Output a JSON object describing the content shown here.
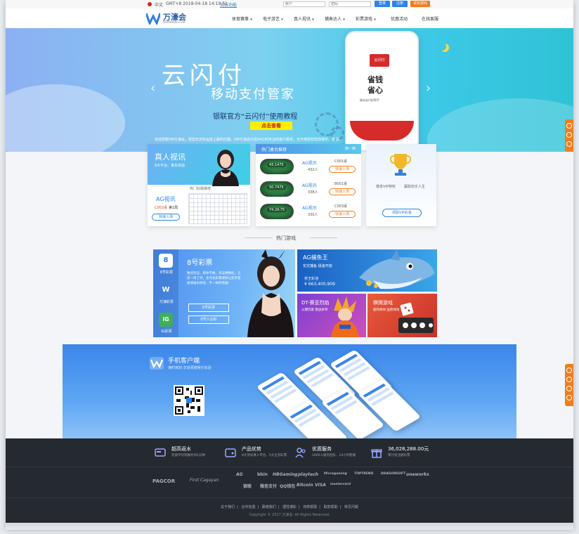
{
  "topbar": {
    "lang": "中文",
    "time": "GMT+8 2018-04-18 14:19:51",
    "demo_link": "试玩功能",
    "account_placeholder": "账户",
    "password_placeholder": "密码",
    "login": "登录",
    "register": "注册",
    "try_play": "试玩游戏"
  },
  "brand": {
    "name": "万濠会",
    "url": "WHHH688.COM",
    "color": "#2d5ea8"
  },
  "nav": [
    {
      "label": "体育赛事",
      "caret": true
    },
    {
      "label": "电子游艺",
      "caret": true
    },
    {
      "label": "真人视讯",
      "caret": true
    },
    {
      "label": "捕鱼达人",
      "caret": true
    },
    {
      "label": "彩票游戏",
      "caret": true
    },
    {
      "label": "优惠活动",
      "caret": false
    },
    {
      "label": "在线客服",
      "caret": false
    }
  ],
  "banner": {
    "title": "云闪付",
    "subtitle": "移动支付管家",
    "tagline": "银联官方“云闪付”使用教程",
    "cta": "点击查看",
    "notice": "欢迎您致VIP万濠会，祝您天天好运连上赢利乐趣。VIP万濠会为您24小时专业的客户服务，全天候轻松陪您娱乐，敬请...",
    "phone": {
      "app_name": "云闪付",
      "line1": "省钱",
      "line2": "省心",
      "line3": "移动支付好帮手"
    }
  },
  "live": {
    "title": "真人视讯",
    "desc": "8大平台、真实体验",
    "hot_label": "热门好路推荐",
    "game": "AG视讯",
    "room": "C002桌",
    "shoe": "第1局",
    "enter": "快速入场"
  },
  "tables": {
    "header": "热门桌台推荐",
    "more": "换一换",
    "rows": [
      {
        "id": "43.1475",
        "name": "AG视讯",
        "people": "432人",
        "code": "C001桌",
        "enter": "快速入场"
      },
      {
        "id": "50.7475",
        "name": "AG视讯",
        "people": "338人",
        "code": "B001桌",
        "enter": "快速入场"
      },
      {
        "id": "74.29.75",
        "name": "AG视讯",
        "people": "330人",
        "code": "C003桌",
        "enter": "快速入场"
      }
    ]
  },
  "vip": {
    "left": "尊享VIP特权",
    "right": "赢取欢乐人生",
    "button": "领取VIP彩金"
  },
  "hot_games_title": "热门游戏",
  "lottery": {
    "title": "8号彩票",
    "desc": "致佳玩法，职体节奏，玩法更精彩，让您一目了然，多元化彩票感知让您享受极速娱乐体验，不一样的惊喜！",
    "sidebar": [
      {
        "icon": "8",
        "label": "8号彩票"
      },
      {
        "icon": "W",
        "label": "万濠彩票"
      },
      {
        "icon": "iG",
        "label": "IG彩票"
      }
    ],
    "buttons": [
      "8号彩票",
      "8号六合彩"
    ]
  },
  "fish": {
    "title": "AG捕鱼王",
    "sub": "花式捕鱼 极速开炮",
    "jackpot_label": "奖王彩池",
    "jackpot": "¥ 663,400,909"
  },
  "dt": {
    "title": "DT-赛亚烈焰",
    "sub": "火爆玩家 激战争夺"
  },
  "chess": {
    "title": "棋牌游戏",
    "sub": "超热休闲 益智休闲"
  },
  "mobile": {
    "title": "手机客户端",
    "sub": "满时离刻 享受便捷娱乐体验"
  },
  "features": [
    {
      "title": "超高返水",
      "desc": "充值平均到账时间1分钟"
    },
    {
      "title": "产品优势",
      "desc": "8大顶尖真人平台、5大主流彩票"
    },
    {
      "title": "优质服务",
      "desc": "2000人服务团队、24小时客服"
    },
    {
      "title": "36,028,288.00元",
      "desc": "累计投注额彩票"
    }
  ],
  "partners_row1": [
    "PAGCOR",
    "First Cagayan",
    "AG",
    "bbin",
    "HBGaming",
    "playtech",
    "Microgaming",
    "TOPTREND",
    "DRAGONSOFT",
    "oneworks"
  ],
  "partners_row2": [
    "银联",
    "微信支付",
    "QQ钱包",
    "Bitcoin",
    "VISA",
    "mastercard"
  ],
  "footer_links": [
    "关于我们",
    "合作加盟",
    "联络我们",
    "理性博彩",
    "存款帮助",
    "取款帮助",
    "常见问题"
  ],
  "copyright": "Copyright © 2017 万濠会. All Rights Reserved.",
  "colors": {
    "accent": "#2b83e6",
    "orange": "#f07d1a",
    "footer": "#252a30"
  }
}
